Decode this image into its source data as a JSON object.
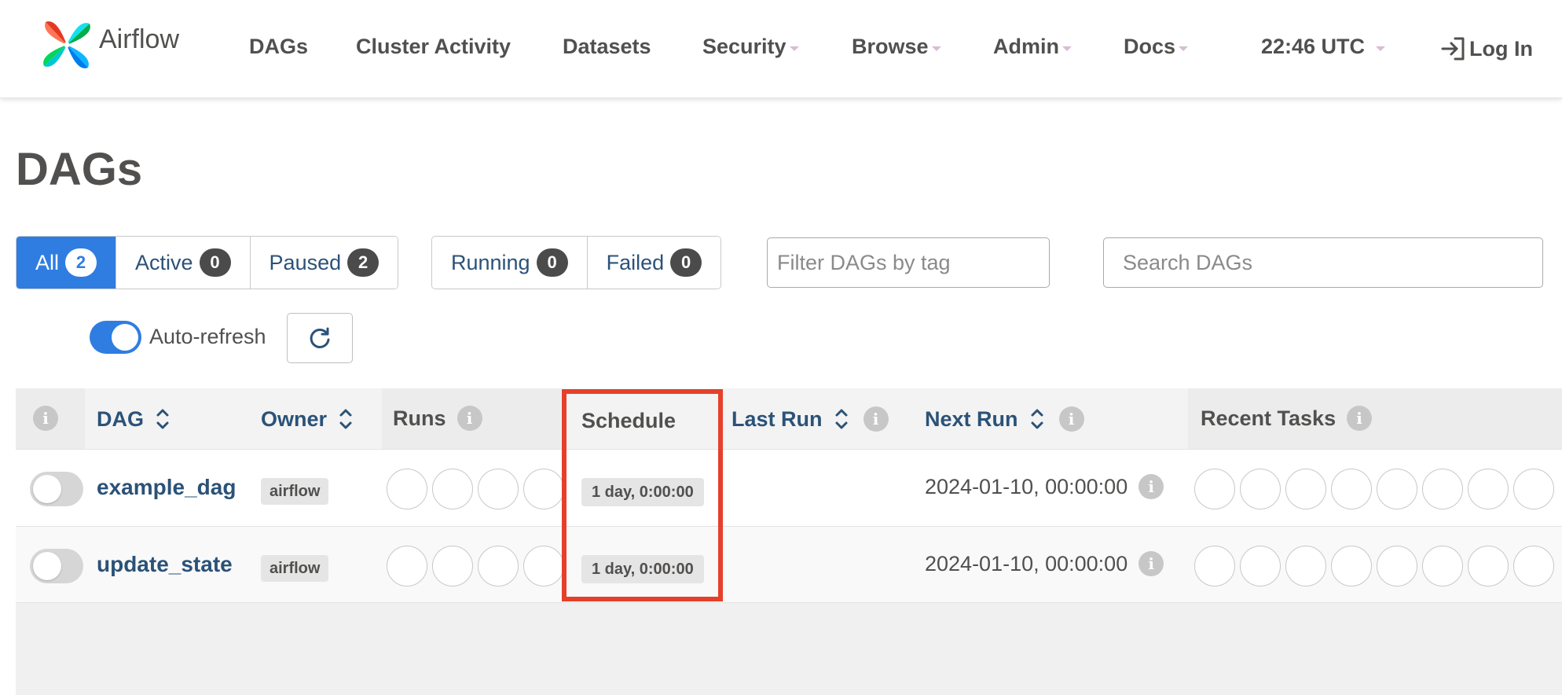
{
  "nav": {
    "brand": "Airflow",
    "items": [
      {
        "label": "DAGs",
        "dropdown": false
      },
      {
        "label": "Cluster Activity",
        "dropdown": false
      },
      {
        "label": "Datasets",
        "dropdown": false
      },
      {
        "label": "Security",
        "dropdown": true
      },
      {
        "label": "Browse",
        "dropdown": true
      },
      {
        "label": "Admin",
        "dropdown": true
      },
      {
        "label": "Docs",
        "dropdown": true
      }
    ],
    "clock": "22:46 UTC",
    "login": "Log In"
  },
  "page_title": "DAGs",
  "filters": {
    "status": [
      {
        "label": "All",
        "count": "2",
        "active": true
      },
      {
        "label": "Active",
        "count": "0",
        "active": false
      },
      {
        "label": "Paused",
        "count": "2",
        "active": false
      }
    ],
    "state": [
      {
        "label": "Running",
        "count": "0"
      },
      {
        "label": "Failed",
        "count": "0"
      }
    ],
    "tag_placeholder": "Filter DAGs by tag",
    "search_placeholder": "Search DAGs"
  },
  "auto_refresh": {
    "label": "Auto-refresh",
    "enabled": true
  },
  "table": {
    "headers": {
      "dag": "DAG",
      "owner": "Owner",
      "runs": "Runs",
      "schedule": "Schedule",
      "last_run": "Last Run",
      "next_run": "Next Run",
      "recent_tasks": "Recent Tasks"
    },
    "info_glyph": "i",
    "rows": [
      {
        "dag_id": "example_dag",
        "owner": "airflow",
        "schedule": "1 day, 0:00:00",
        "last_run": "",
        "next_run": "2024-01-10, 00:00:00",
        "paused": true
      },
      {
        "dag_id": "update_state",
        "owner": "airflow",
        "schedule": "1 day, 0:00:00",
        "last_run": "",
        "next_run": "2024-01-10, 00:00:00",
        "paused": true
      }
    ]
  },
  "colors": {
    "primary": "#2f7de1",
    "link": "#2b5278",
    "highlight": "#e5402b"
  }
}
